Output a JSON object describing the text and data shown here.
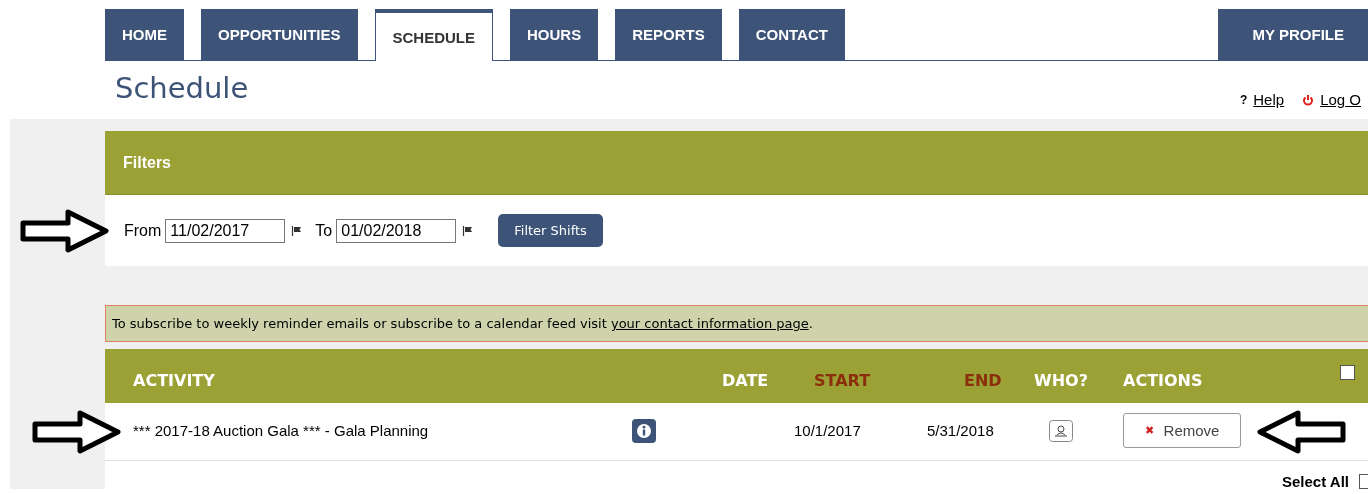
{
  "tabs": [
    {
      "label": "HOME",
      "selected": false
    },
    {
      "label": "OPPORTUNITIES",
      "selected": false
    },
    {
      "label": "SCHEDULE",
      "selected": true
    },
    {
      "label": "HOURS",
      "selected": false
    },
    {
      "label": "REPORTS",
      "selected": false
    },
    {
      "label": "CONTACT",
      "selected": false
    }
  ],
  "profile_tab": {
    "label": "MY PROFILE",
    "selected": false
  },
  "page_title": "Schedule",
  "top_links": [
    {
      "icon": "?",
      "label": "Help",
      "kind": "help"
    },
    {
      "label": "Log O",
      "kind": "logout"
    }
  ],
  "filters": {
    "title": "Filters",
    "from_label": "From",
    "from_value": "11/02/2017",
    "to_label": "To",
    "to_value": "01/02/2018",
    "button": "Filter Shifts"
  },
  "notice": {
    "text": "To subscribe to weekly reminder emails or subscribe to a calendar feed visit ",
    "link": "your contact information page",
    "end": "."
  },
  "table": {
    "columns": [
      {
        "label": "ACTIVITY",
        "color": "#ffffff"
      },
      {
        "label": "DATE",
        "color": "#ffffff"
      },
      {
        "label": "START",
        "color": "#8a2e0c"
      },
      {
        "label": "END",
        "color": "#8a2e0c"
      },
      {
        "label": "WHO?",
        "color": "#ffffff"
      },
      {
        "label": "ACTIONS",
        "color": "#ffffff"
      }
    ],
    "header_checked": false,
    "rows": [
      {
        "activity": "*** 2017-18 Auction Gala *** - Gala Planning",
        "start": "10/1/2017",
        "end": "5/31/2018",
        "action": "Remove",
        "action_icon": "✖"
      }
    ],
    "select_all": {
      "label": "Select All",
      "checked": false
    }
  }
}
